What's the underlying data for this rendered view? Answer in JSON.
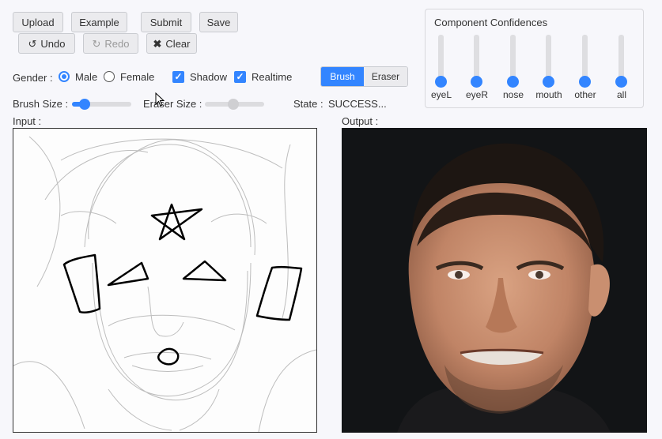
{
  "toolbar": {
    "upload_label": "Upload",
    "example_label": "Example",
    "submit_label": "Submit",
    "save_label": "Save",
    "undo_label": "Undo",
    "redo_label": "Redo",
    "clear_label": "Clear"
  },
  "options": {
    "gender_label": "Gender :",
    "male_label": "Male",
    "female_label": "Female",
    "gender_selected": "Male",
    "shadow_label": "Shadow",
    "shadow_checked": true,
    "realtime_label": "Realtime",
    "realtime_checked": true
  },
  "tool_toggle": {
    "brush_label": "Brush",
    "eraser_label": "Eraser",
    "active": "Brush"
  },
  "sliders": {
    "brush_size_label": "Brush Size :",
    "brush_size_level": 0.2,
    "eraser_size_label": "Eraser Size :",
    "eraser_size_level": 0.5
  },
  "state": {
    "label": "State :",
    "value": "SUCCESS..."
  },
  "confidences": {
    "title": "Component Confidences",
    "items": [
      {
        "label": "eyeL",
        "level": 0
      },
      {
        "label": "eyeR",
        "level": 0
      },
      {
        "label": "nose",
        "level": 0
      },
      {
        "label": "mouth",
        "level": 0
      },
      {
        "label": "other",
        "level": 0
      },
      {
        "label": "all",
        "level": 0
      }
    ]
  },
  "canvas": {
    "input_label": "Input :",
    "output_label": "Output :"
  },
  "colors": {
    "accent": "#3385ff",
    "button_bg": "#ebebee",
    "page_bg": "#f7f7fb"
  },
  "icons": {
    "undo": "undo-icon",
    "redo": "redo-icon",
    "clear": "close-icon"
  }
}
